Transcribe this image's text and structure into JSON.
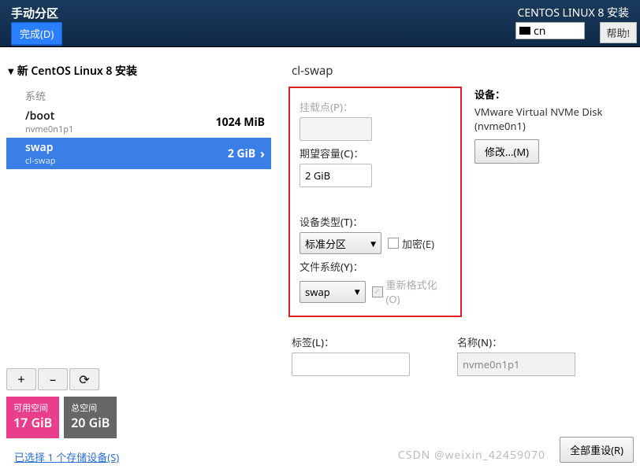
{
  "header": {
    "title": "手动分区",
    "right_title": "CENTOS LINUX 8 安装",
    "done_button": "完成(D)",
    "lang": "cn",
    "help_button": "帮助!"
  },
  "tree": {
    "title": "新 CentOS Linux 8 安装",
    "system_label": "系统",
    "partitions": [
      {
        "name": "/boot",
        "device": "nvme0n1p1",
        "size": "1024 MiB",
        "selected": false
      },
      {
        "name": "swap",
        "device": "cl-swap",
        "size": "2 GiB",
        "selected": true
      }
    ]
  },
  "buttons": {
    "add": "+",
    "remove": "–",
    "reload": "⟳"
  },
  "space": {
    "available_label": "可用空间",
    "available_value": "17 GiB",
    "total_label": "总空间",
    "total_value": "20 GiB"
  },
  "storage_link": "已选择 1 个存储设备(S)",
  "detail": {
    "title": "cl-swap",
    "mount_label": "挂载点(P)：",
    "mount_value": "",
    "capacity_label": "期望容量(C)：",
    "capacity_value": "2 GiB",
    "devtype_label": "设备类型(T)：",
    "devtype_value": "标准分区",
    "encrypt_label": "加密(E)",
    "fs_label": "文件系统(Y)：",
    "fs_value": "swap",
    "reformat_label": "重新格式化(O)",
    "tag_label": "标签(L)：",
    "tag_value": "",
    "name_label": "名称(N)：",
    "name_value": "nvme0n1p1",
    "device_heading": "设备：",
    "device_text": "VMware Virtual NVMe Disk (nvme0n1)",
    "modify_button": "修改...(M)",
    "reset_button": "全部重设(R)"
  },
  "watermark": "CSDN @weixin_42459070"
}
